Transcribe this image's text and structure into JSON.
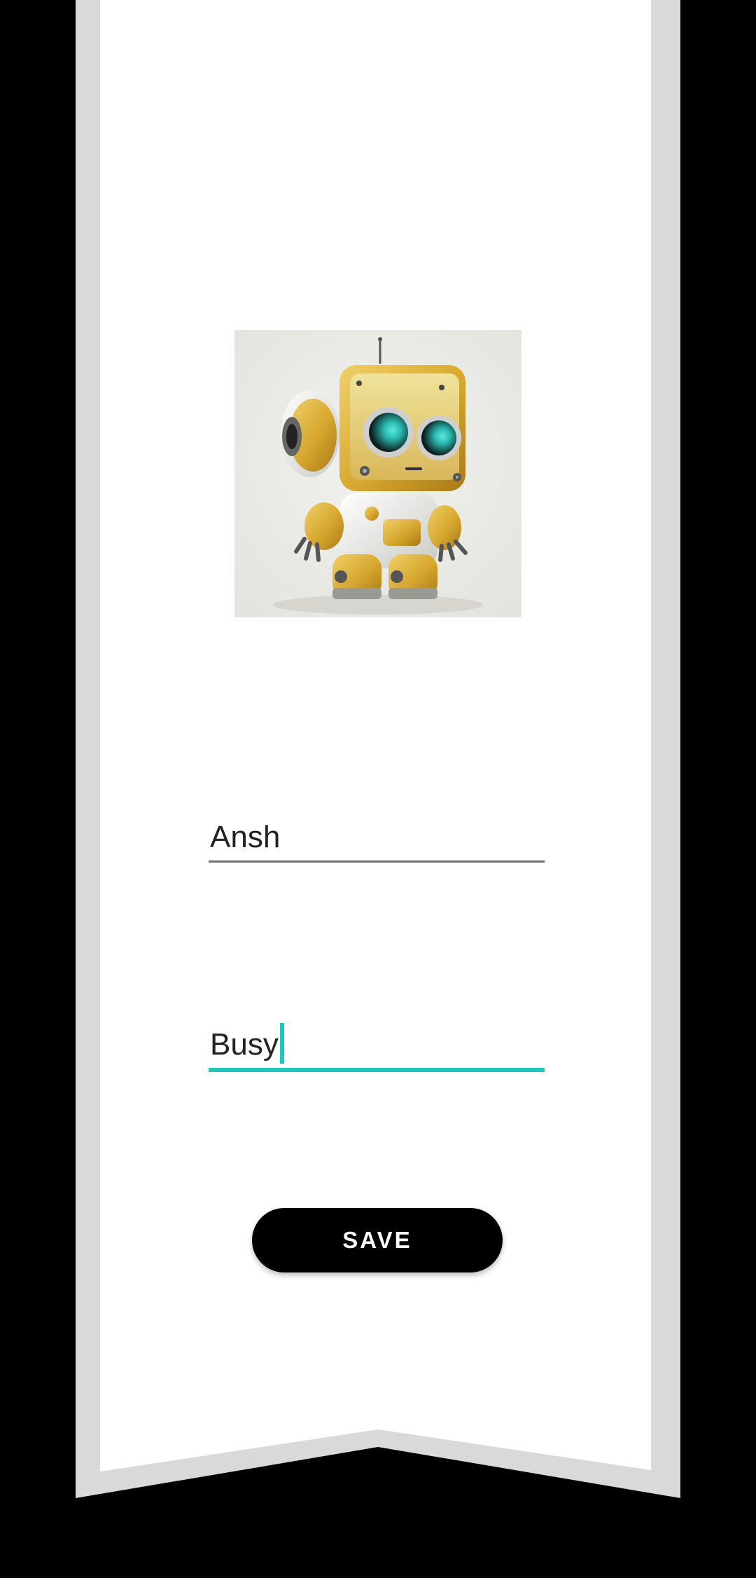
{
  "profile": {
    "avatar_icon": "robot-avatar-image",
    "name_value": "Ansh",
    "status_value": "Busy",
    "save_label": "SAVE"
  },
  "colors": {
    "accent": "#1ec8bd",
    "banner_outer": "#d9d9d9",
    "banner_inner": "#ffffff",
    "button": "#000000",
    "background": "#000000"
  }
}
